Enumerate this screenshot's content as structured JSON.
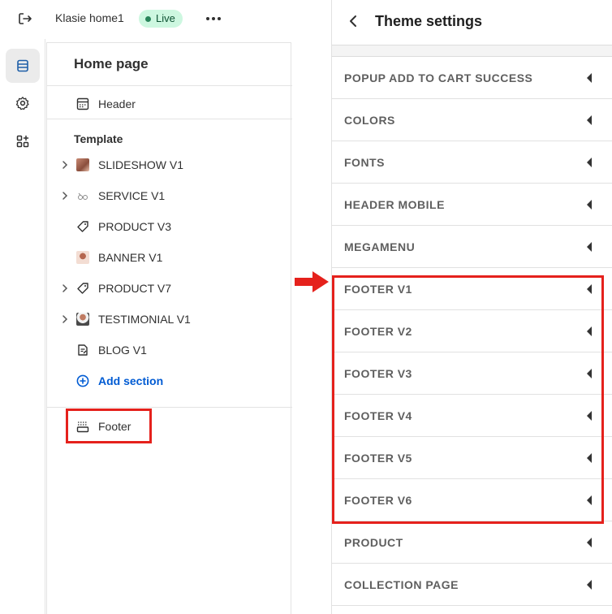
{
  "topbar": {
    "store_name": "Klasie home1",
    "live_label": "Live"
  },
  "rail": {
    "items": [
      {
        "icon": "sections-icon",
        "active": true
      },
      {
        "icon": "gear-icon",
        "active": false
      },
      {
        "icon": "apps-icon",
        "active": false
      }
    ]
  },
  "panel": {
    "title": "Home page",
    "header_label": "Header",
    "template_label": "Template",
    "sections": [
      {
        "label": "SLIDESHOW V1",
        "icon": "image-thumb-icon",
        "expandable": true
      },
      {
        "label": "SERVICE V1",
        "icon": "service-thumb-icon",
        "expandable": true
      },
      {
        "label": "PRODUCT V3",
        "icon": "tag-icon",
        "expandable": false
      },
      {
        "label": "BANNER V1",
        "icon": "image-thumb-icon",
        "expandable": false
      },
      {
        "label": "PRODUCT V7",
        "icon": "tag-icon",
        "expandable": true
      },
      {
        "label": "TESTIMONIAL V1",
        "icon": "person-thumb-icon",
        "expandable": true
      },
      {
        "label": "BLOG V1",
        "icon": "blog-icon",
        "expandable": false
      }
    ],
    "add_section_label": "Add section",
    "footer_label": "Footer"
  },
  "theme_settings": {
    "title": "Theme settings",
    "items": [
      "POPUP ADD TO CART SUCCESS",
      "COLORS",
      "FONTS",
      "HEADER MOBILE",
      "MEGAMENU",
      "FOOTER V1",
      "FOOTER V2",
      "FOOTER V3",
      "FOOTER V4",
      "FOOTER V5",
      "FOOTER V6",
      "PRODUCT",
      "COLLECTION PAGE"
    ]
  },
  "colors": {
    "highlight": "#e5211c",
    "live_bg": "#cdf7e0",
    "link": "#005bd3"
  }
}
